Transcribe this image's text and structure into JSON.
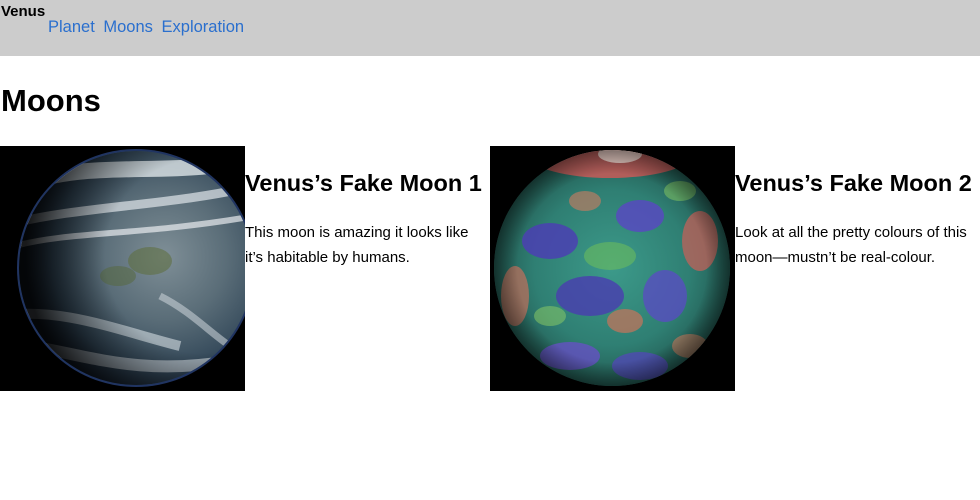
{
  "header": {
    "site_title": "Venus",
    "nav": [
      {
        "label": "Planet"
      },
      {
        "label": "Moons"
      },
      {
        "label": "Exploration"
      }
    ]
  },
  "main": {
    "heading": "Moons",
    "cards": [
      {
        "title": "Venus’s Fake Moon 1",
        "text": "This moon is amazing it looks like it’s habitable by humans.",
        "image": "earth-like moon globe with clouds"
      },
      {
        "title": "Venus’s Fake Moon 2",
        "text": "Look at all the pretty colours of this moon—mustn’t be real-colour.",
        "image": "false-colour topographic moon globe"
      }
    ]
  }
}
